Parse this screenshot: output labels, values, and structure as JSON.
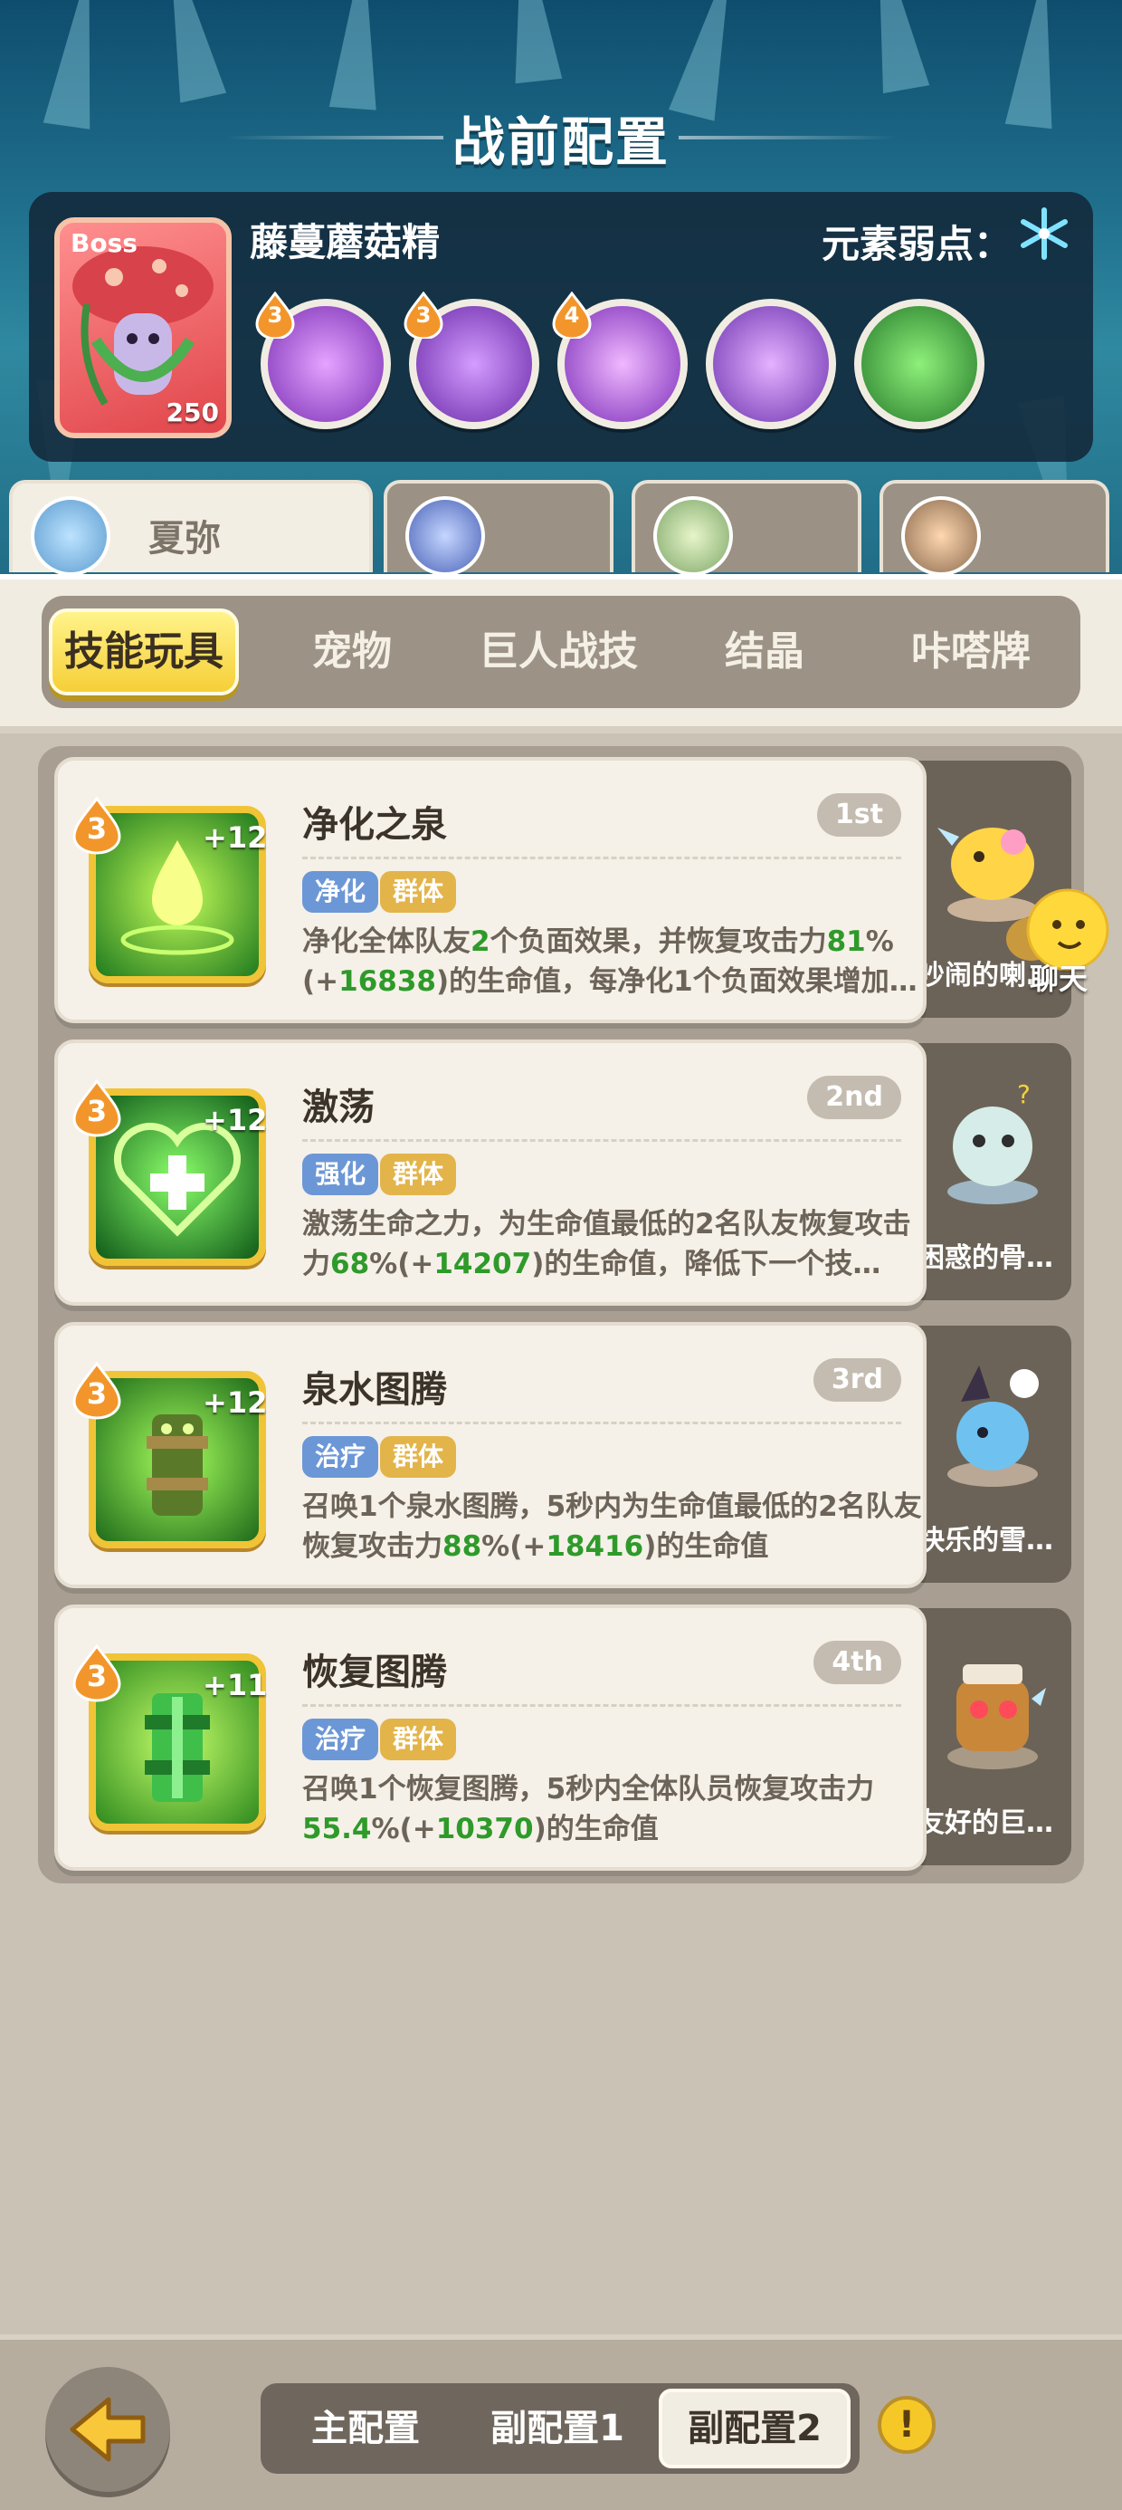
{
  "header": {
    "title": "战前配置"
  },
  "boss": {
    "tag": "Boss",
    "name": "藤蔓蘑菇精",
    "level": "250",
    "weakness_label": "元素弱点：",
    "weakness_icon": "snowflake-icon",
    "skills": [
      {
        "level": "3",
        "color": "#a84fd4",
        "icon": "purple-swirl-book-icon"
      },
      {
        "level": "3",
        "color": "#8a4fd0",
        "icon": "purple-mushroom-drops-icon"
      },
      {
        "level": "4",
        "color": "#9b48d8",
        "icon": "purple-mushroom-burst-icon"
      },
      {
        "level": "",
        "color": "#8e54d6",
        "icon": "purple-mushroom-shield-icon"
      },
      {
        "level": "",
        "color": "#3aa63f",
        "icon": "green-slime-icon"
      }
    ]
  },
  "characters": [
    {
      "name": "夏弥",
      "active": true
    },
    {
      "name": "",
      "active": false
    },
    {
      "name": "",
      "active": false
    },
    {
      "name": "",
      "active": false
    }
  ],
  "categories": [
    "技能玩具",
    "宠物",
    "巨人战技",
    "结晶",
    "咔嗒牌"
  ],
  "active_category": "技能玩具",
  "skills": [
    {
      "title": "净化之泉",
      "rank": "1st",
      "level": "3",
      "plus": "+12",
      "tags": [
        "净化",
        "群体"
      ],
      "desc_parts": [
        "净化全体队友",
        "2",
        "个负面效果，并恢复攻击力",
        "81",
        "%(+",
        "16838",
        ")的生命值，每净化1个负面效果增加…"
      ],
      "pet_name": "吵闹的喇…",
      "icon": "water-drop-icon"
    },
    {
      "title": "激荡",
      "rank": "2nd",
      "level": "3",
      "plus": "+12",
      "tags": [
        "强化",
        "群体"
      ],
      "desc_parts": [
        "激荡生命之力，为生命值最低的2名队友恢复攻击力",
        "68",
        "%(+",
        "14207",
        ")的生命值，降低下一个技…",
        "",
        ""
      ],
      "pet_name": "困惑的骨…",
      "icon": "heart-cross-icon"
    },
    {
      "title": "泉水图腾",
      "rank": "3rd",
      "level": "3",
      "plus": "+12",
      "tags": [
        "治疗",
        "群体"
      ],
      "desc_parts": [
        "召唤1个泉水图腾，5秒内为生命值最低的2名队友恢复攻击力",
        "88",
        "%(+",
        "18416",
        ")的生命值",
        "",
        ""
      ],
      "pet_name": "快乐的雪…",
      "icon": "spring-totem-icon"
    },
    {
      "title": "恢复图腾",
      "rank": "4th",
      "level": "3",
      "plus": "+11",
      "tags": [
        "治疗",
        "群体"
      ],
      "desc_parts": [
        "召唤1个恢复图腾，5秒内全体队员恢复攻击力",
        "55.4",
        "%(+",
        "10370",
        ")的生命值",
        "",
        ""
      ],
      "pet_name": "友好的巨…",
      "icon": "recovery-totem-icon"
    }
  ],
  "chat": {
    "label": "聊天"
  },
  "bottom": {
    "configs": [
      "主配置",
      "副配置1",
      "副配置2"
    ],
    "active_config": "副配置2",
    "warn_symbol": "!"
  }
}
